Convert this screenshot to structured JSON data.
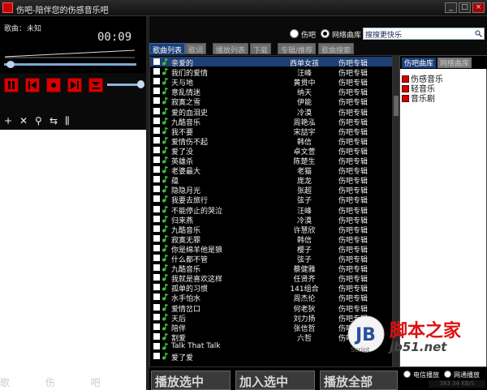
{
  "window": {
    "title": "伤吧-陪伴您的伤感音乐吧",
    "minimize_label": "_",
    "maximize_label": "□",
    "close_label": "×"
  },
  "player": {
    "song_label": "歌曲：",
    "song_name": "未知",
    "time": "00:09",
    "seek_progress": 0.02,
    "volume": 0.92
  },
  "source": {
    "local_label": "伤吧",
    "online_label": "网络曲库",
    "selected": "online"
  },
  "search": {
    "value": "搜搜更快乐"
  },
  "tabs": [
    {
      "label": "歌曲列表",
      "active": true
    },
    {
      "label": "歌词",
      "active": false
    },
    {
      "label": "播放列表",
      "active": false
    },
    {
      "label": "下载",
      "active": false
    },
    {
      "label": "专辑/推荐",
      "active": false
    },
    {
      "label": "歌曲搜索",
      "active": false
    }
  ],
  "songs": [
    {
      "title": "亲爱的",
      "artist": "西单女孩",
      "album": "伤吧专辑"
    },
    {
      "title": "我们的爱情",
      "artist": "汪峰",
      "album": "伤吧专辑"
    },
    {
      "title": "天与地",
      "artist": "黄贯中",
      "album": "伤吧专辑"
    },
    {
      "title": "意乱情迷",
      "artist": "纳天",
      "album": "伤吧专辑"
    },
    {
      "title": "寂寞之雪",
      "artist": "伊能",
      "album": "伤吧专辑"
    },
    {
      "title": "爱的血泪史",
      "artist": "冷漠",
      "album": "伤吧专辑"
    },
    {
      "title": "九酷音乐",
      "artist": "周艳泓",
      "album": "伤吧专辑"
    },
    {
      "title": "我不要",
      "artist": "宋喆宇",
      "album": "伤吧专辑"
    },
    {
      "title": "爱情伤不起",
      "artist": "韩信",
      "album": "伤吧专辑"
    },
    {
      "title": "爱了没",
      "artist": "卓文萱",
      "album": "伤吧专辑"
    },
    {
      "title": "英雄杀",
      "artist": "陈楚生",
      "album": "伤吧专辑"
    },
    {
      "title": "老婆最大",
      "artist": "老猫",
      "album": "伤吧专辑"
    },
    {
      "title": "蕴",
      "artist": "庞龙",
      "album": "伤吧专辑"
    },
    {
      "title": "隐隐月光",
      "artist": "张超",
      "album": "伤吧专辑"
    },
    {
      "title": "我要去旅行",
      "artist": "弦子",
      "album": "伤吧专辑"
    },
    {
      "title": "不能停止的哭泣",
      "artist": "汪峰",
      "album": "伤吧专辑"
    },
    {
      "title": "归来燕",
      "artist": "冷漠",
      "album": "伤吧专辑"
    },
    {
      "title": "九酷音乐",
      "artist": "许慧欣",
      "album": "伤吧专辑"
    },
    {
      "title": "寂寞无罪",
      "artist": "韩信",
      "album": "伤吧专辑"
    },
    {
      "title": "你是绵羊他是狼",
      "artist": "樱子",
      "album": "伤吧专辑"
    },
    {
      "title": "什么都不管",
      "artist": "弦子",
      "album": "伤吧专辑"
    },
    {
      "title": "九酷音乐",
      "artist": "蔡健雅",
      "album": "伤吧专辑"
    },
    {
      "title": "我就是喜欢这样",
      "artist": "任贤齐",
      "album": "伤吧专辑"
    },
    {
      "title": "孤单的习惯",
      "artist": "141组合",
      "album": "伤吧专辑"
    },
    {
      "title": "水手怕水",
      "artist": "周杰伦",
      "album": "伤吧专辑"
    },
    {
      "title": "爱情岔口",
      "artist": "何老狄",
      "album": "伤吧专辑"
    },
    {
      "title": "天后",
      "artist": "刘力扬",
      "album": "伤吧专辑"
    },
    {
      "title": "陪伴",
      "artist": "张信哲",
      "album": "伤吧专辑"
    },
    {
      "title": "割爱",
      "artist": "六哲",
      "album": "伤吧专辑"
    },
    {
      "title": "Talk That Talk",
      "artist": "",
      "album": ""
    },
    {
      "title": "爱了爱",
      "artist": "",
      "album": ""
    }
  ],
  "library": {
    "tabs": [
      {
        "label": "伤吧曲库",
        "active": true
      },
      {
        "label": "网络曲库",
        "active": false
      }
    ],
    "items": [
      "伤感音乐",
      "轻音乐",
      "音乐剧"
    ]
  },
  "bottom": {
    "play_selected": "播放选中",
    "add_selected": "加入选中",
    "play_all": "播放全部",
    "mode_a": "电信播放",
    "mode_b": "网通播放",
    "status": "383 34 KB/S"
  },
  "watermark": {
    "brand": "脚本之家",
    "url": "jb51.net",
    "script": "Script",
    "letter": "JB"
  },
  "left_ghost": "歌 伤 吧",
  "colors": {
    "accent_red": "#d80000",
    "tab_blue": "#1a3f7a",
    "seek_blue": "#7fa9d6",
    "note_green": "#3cbf3c"
  }
}
